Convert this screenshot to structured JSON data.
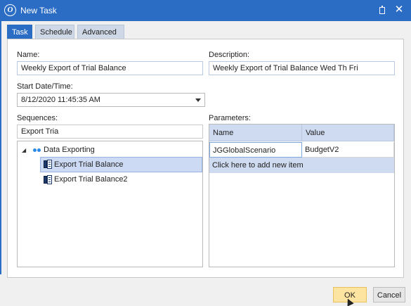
{
  "window": {
    "title": "New Task"
  },
  "tabs": [
    {
      "label": "Task",
      "active": true
    },
    {
      "label": "Schedule",
      "active": false
    },
    {
      "label": "Advanced",
      "active": false
    }
  ],
  "form": {
    "name_label": "Name:",
    "name_value": "Weekly Export of Trial Balance",
    "description_label": "Description:",
    "description_value": "Weekly Export of Trial Balance Wed Th Fri",
    "start_label": "Start Date/Time:",
    "start_value": "8/12/2020 11:45:35 AM",
    "sequences_label": "Sequences:",
    "sequences_filter": "Export Tria",
    "parameters_label": "Parameters:"
  },
  "tree": {
    "root": "Data Exporting",
    "items": [
      "Export Trial Balance",
      "Export Trial Balance2"
    ],
    "selected_index": 0
  },
  "parameters": {
    "columns": [
      "Name",
      "Value"
    ],
    "rows": [
      {
        "name": "JGGlobalScenario",
        "value": "BudgetV2"
      }
    ],
    "add_row_label": "Click here to add new item"
  },
  "buttons": {
    "ok": "OK",
    "cancel": "Cancel"
  },
  "colors": {
    "accent": "#2b6cc4",
    "selection": "#ccdaf3",
    "ok_button": "#fde4a1"
  }
}
